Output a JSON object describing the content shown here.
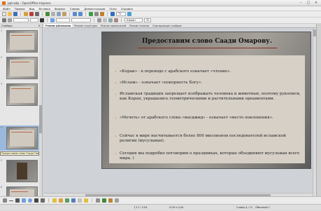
{
  "window": {
    "title": "ppt.odp - OpenOffice Impress"
  },
  "menu": [
    "Файл",
    "Правка",
    "Вид",
    "Вставка",
    "Формат",
    "Сервис",
    "Демонстрация",
    "Окно",
    "Справка"
  ],
  "toolbar": {
    "zoom_value": "72",
    "font_name": "Шрифт",
    "font_size": "32"
  },
  "slides_pane": {
    "title": "Слайды",
    "thumbnails": [
      {
        "num": "1"
      },
      {
        "num": "2"
      },
      {
        "num": "3"
      },
      {
        "num": "4"
      },
      {
        "num": "5"
      },
      {
        "num": "6"
      }
    ],
    "tooltip": "Предоставим слово Саади Омарову."
  },
  "view_tabs": [
    "Режим рисования",
    "Режим структуры",
    "Режим примечаний",
    "Режим тезисов",
    "Сортировщик слайдов"
  ],
  "slide": {
    "title": "Предоставим слово Саади Омарову.",
    "bullets": [
      "«Коран» - в переводе с арабского означает «чтение».",
      "«Ислам» - означает «покорность Богу».",
      "Исламская традиция запрещает изображать человека и животных, поэтому рукописи, как Коран, украшались геометрическими и растительными орнаментами.",
      "«Мечеть» от арабского слова «масджид» - означает «место поклонения».",
      "Сейчас в мире насчитывается более 800 миллионов последователей исламской религии (мусульман).",
      "Сегодня мы подробно поговорим о праздниках, которые объединяют мусульман всего мира. )"
    ]
  },
  "status": {
    "position": "7,17 / 3,54",
    "size": "0,00 x 0,00",
    "slide_info": "Слайд 4 / 11",
    "layout": "Обычный 1"
  },
  "colors": {
    "bullet_dot": "#d98430",
    "title_underline": "#8a2e18",
    "active_thumb": "#9bb9dc"
  }
}
